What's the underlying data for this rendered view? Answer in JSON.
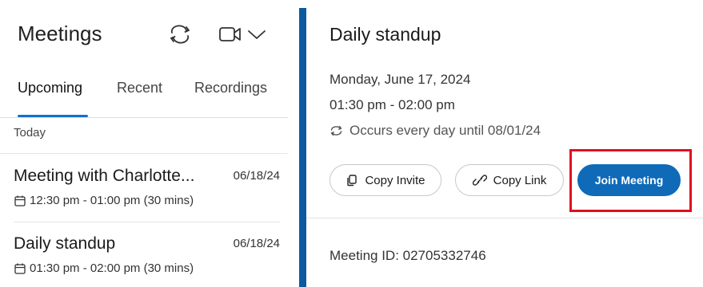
{
  "left": {
    "title": "Meetings",
    "icons": {
      "sync": "sync-icon",
      "video": "video-camera-icon",
      "chevron": "chevron-down-icon"
    },
    "tabs": [
      {
        "label": "Upcoming",
        "active": true
      },
      {
        "label": "Recent",
        "active": false
      },
      {
        "label": "Recordings",
        "active": false
      }
    ],
    "section_label": "Today",
    "meetings": [
      {
        "title": "Meeting with Charlotte...",
        "date": "06/18/24",
        "time": "12:30 pm - 01:00 pm (30 mins)"
      },
      {
        "title": "Daily standup",
        "date": "06/18/24",
        "time": "01:30 pm - 02:00 pm (30 mins)"
      }
    ]
  },
  "detail": {
    "title": "Daily standup",
    "date": "Monday, June 17, 2024",
    "time": "01:30 pm - 02:00 pm",
    "recurrence": "Occurs every day until 08/01/24",
    "buttons": {
      "copy_invite": "Copy Invite",
      "copy_link": "Copy Link",
      "join": "Join Meeting"
    },
    "meeting_id": "Meeting ID: 02705332746"
  },
  "colors": {
    "accent": "#1170cf",
    "join_button": "#0f6ab8",
    "splitter": "#0b5aa0",
    "highlight": "#e0101f"
  }
}
